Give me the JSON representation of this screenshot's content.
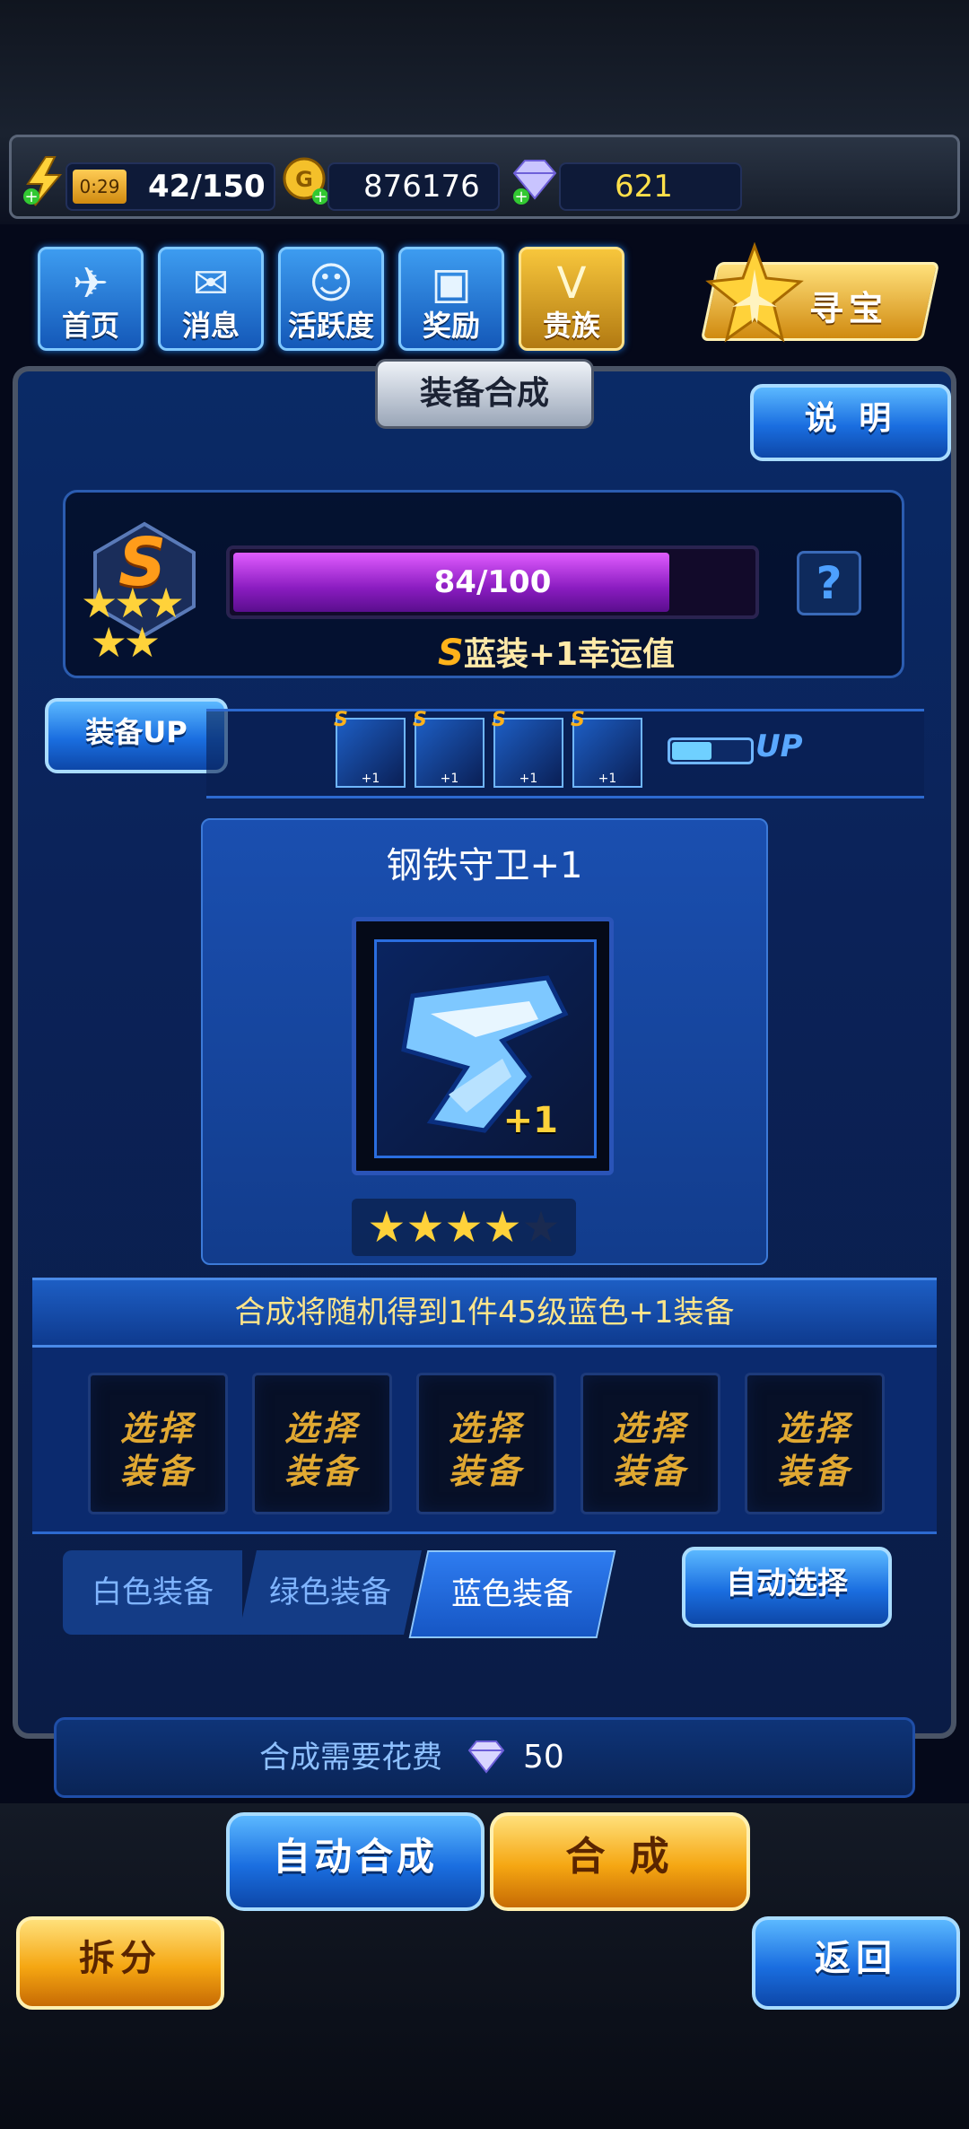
{
  "resources": {
    "timer": "0:29",
    "energy": "42/150",
    "gold": "876176",
    "diamonds": "621"
  },
  "nav": [
    {
      "label": "首页",
      "icon": "home-icon"
    },
    {
      "label": "消息",
      "icon": "message-icon"
    },
    {
      "label": "活跃度",
      "icon": "activity-icon"
    },
    {
      "label": "奖励",
      "icon": "gift-icon"
    },
    {
      "label": "贵族",
      "icon": "noble-icon"
    }
  ],
  "treasure_label": "寻宝",
  "panel": {
    "title": "装备合成",
    "help_label": "说 明",
    "rank": "S",
    "luck_progress": "84/100",
    "luck_fraction": 0.84,
    "luck_text": "蓝装+1幸运值",
    "luck_rank": "S",
    "equip_up_label": "装备UP",
    "up_label": "UP",
    "mini_items": [
      {
        "rank": "S",
        "plus": "+1"
      },
      {
        "rank": "S",
        "plus": "+1"
      },
      {
        "rank": "S",
        "plus": "+1"
      },
      {
        "rank": "S",
        "plus": "+1"
      }
    ],
    "item_name": "钢铁守卫+1",
    "item_plus": "+1",
    "stars_filled": 4,
    "stars_total": 5,
    "info": "合成将随机得到1件45级蓝色+1装备",
    "slot_line1": "选择",
    "slot_line2": "装备",
    "tabs": [
      "白色装备",
      "绿色装备",
      "蓝色装备"
    ],
    "active_tab": 2,
    "auto_select_label": "自动选择"
  },
  "cost": {
    "label": "合成需要花费",
    "value": "50"
  },
  "buttons": {
    "auto_combine": "自动合成",
    "combine": "合 成",
    "split": "拆分",
    "back": "返回"
  },
  "colors": {
    "accent_blue": "#1a6ee0",
    "gold": "#f5a612",
    "progress_purple": "#a22ad6"
  }
}
